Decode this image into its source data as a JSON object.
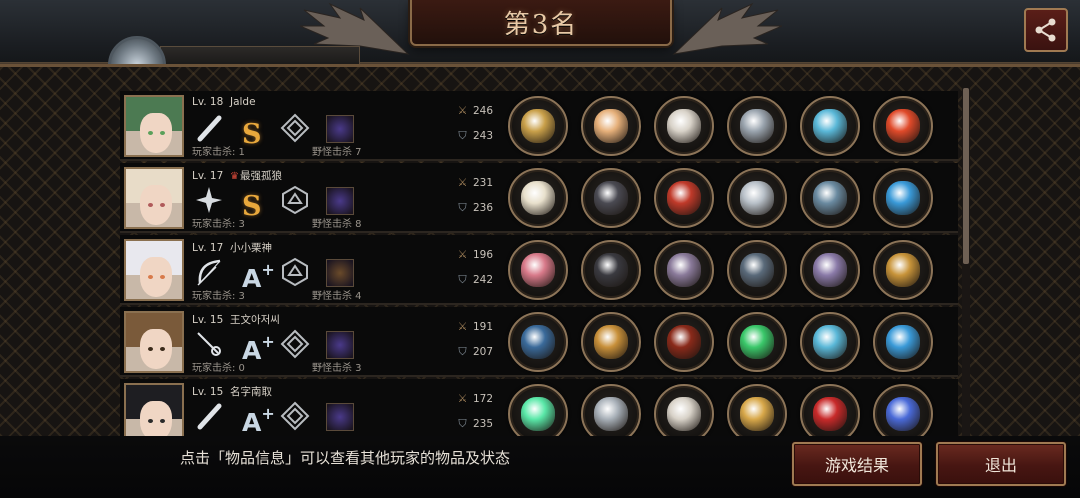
{
  "header": {
    "title": "第3名"
  },
  "players": [
    {
      "level": "Lv. 18",
      "name": "Jalde",
      "crown": false,
      "grade": "S",
      "grade_plus": "",
      "weapon_icon": "bat-icon",
      "rank_icon": "diamond-rank-icon",
      "monster_icon": "purple-monster-icon",
      "kills": "玩家击杀: 1",
      "monster_kills": "野怪击杀 7",
      "atk": "246",
      "def": "243",
      "hair": "#4c7a52",
      "eye": "#5aa05a",
      "items": [
        {
          "name": "whip-icon",
          "color": "#c9a04a"
        },
        {
          "name": "tiara-icon",
          "color": "#e6b07a"
        },
        {
          "name": "armor-icon",
          "color": "#d8d2c8"
        },
        {
          "name": "shield-disc-icon",
          "color": "#9aa4ae"
        },
        {
          "name": "sneaker-icon",
          "color": "#5ab8d8"
        },
        {
          "name": "red-gem-icon",
          "color": "#e04a2a"
        }
      ]
    },
    {
      "level": "Lv. 17",
      "name": "最强孤狼",
      "crown": true,
      "grade": "S",
      "grade_plus": "",
      "weapon_icon": "shuriken-icon",
      "rank_icon": "hex-rank-icon",
      "monster_icon": "purple-monster-icon",
      "kills": "玩家击杀: 3",
      "monster_kills": "野怪击杀 8",
      "atk": "231",
      "def": "236",
      "hair": "#e8dcc8",
      "eye": "#b05a5a",
      "items": [
        {
          "name": "feather-fan-icon",
          "color": "#e8e0cc"
        },
        {
          "name": "dark-helmet-icon",
          "color": "#4a4a52"
        },
        {
          "name": "red-cloak-icon",
          "color": "#c03a2a"
        },
        {
          "name": "spiked-bracer-icon",
          "color": "#b8c0c8"
        },
        {
          "name": "armored-boots-icon",
          "color": "#6a8aa0"
        },
        {
          "name": "blue-necklace-icon",
          "color": "#3a9ad8"
        }
      ]
    },
    {
      "level": "Lv. 17",
      "name": "小小栗神",
      "crown": false,
      "grade": "A",
      "grade_plus": "+",
      "weapon_icon": "bow-icon",
      "rank_icon": "hex-rank-icon",
      "monster_icon": "brown-monster-icon",
      "kills": "玩家击杀: 3",
      "monster_kills": "野怪击杀 4",
      "atk": "196",
      "def": "242",
      "hair": "#e8e8ee",
      "eye": "#d87a4a",
      "items": [
        {
          "name": "crossbow-icon",
          "color": "#d87a8a"
        },
        {
          "name": "spiked-helmet-icon",
          "color": "#3a3a40"
        },
        {
          "name": "plate-armor-icon",
          "color": "#8a7a9a"
        },
        {
          "name": "watch-icon",
          "color": "#5a6a7a"
        },
        {
          "name": "purple-boots-icon",
          "color": "#8a7aa8"
        },
        {
          "name": "treasure-box-icon",
          "color": "#c8943a"
        }
      ]
    },
    {
      "level": "Lv. 15",
      "name": "王文아저씨",
      "crown": false,
      "grade": "A",
      "grade_plus": "+",
      "weapon_icon": "rapier-icon",
      "rank_icon": "diamond-rank-icon",
      "monster_icon": "purple-monster-icon",
      "kills": "玩家击杀: 0",
      "monster_kills": "野怪击杀 3",
      "atk": "191",
      "def": "207",
      "hair": "#7a5a3a",
      "eye": "#3a2a1a",
      "items": [
        {
          "name": "blue-spear-icon",
          "color": "#3a6a9a"
        },
        {
          "name": "gold-helmet-icon",
          "color": "#c8903a"
        },
        {
          "name": "red-armor-icon",
          "color": "#8a2a1a"
        },
        {
          "name": "circuit-chip-icon",
          "color": "#3ac86a"
        },
        {
          "name": "sneaker-icon",
          "color": "#5ab8d8"
        },
        {
          "name": "blue-necklace-icon",
          "color": "#3a9ad8"
        }
      ]
    },
    {
      "level": "Lv. 15",
      "name": "名字南取",
      "crown": false,
      "grade": "A",
      "grade_plus": "+",
      "weapon_icon": "bat-icon",
      "rank_icon": "diamond-rank-icon",
      "monster_icon": "purple-monster-icon",
      "kills": "",
      "monster_kills": "",
      "atk": "172",
      "def": "235",
      "hair": "#1e1e22",
      "eye": "#2a2a2a",
      "items": [
        {
          "name": "twin-swords-icon",
          "color": "#5ae8a8"
        },
        {
          "name": "knight-helmet-icon",
          "color": "#a8b0b8"
        },
        {
          "name": "armor-icon",
          "color": "#d8d2c8"
        },
        {
          "name": "gold-shield-icon",
          "color": "#d8a84a"
        },
        {
          "name": "red-heels-icon",
          "color": "#c82a2a"
        },
        {
          "name": "galaxy-orb-icon",
          "color": "#4a6ad8"
        }
      ]
    }
  ],
  "footer": {
    "tip": "点击「物品信息」可以查看其他玩家的物品及状态",
    "result_button": "游戏结果",
    "exit_button": "退出"
  }
}
